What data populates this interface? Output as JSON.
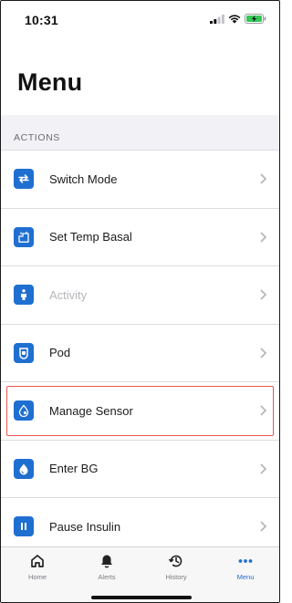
{
  "status_bar": {
    "time": "10:31",
    "icons": [
      "signal-icon",
      "wifi-icon",
      "battery-charging-icon"
    ]
  },
  "page": {
    "title": "Menu"
  },
  "section": {
    "header": "ACTIONS"
  },
  "menu_items": [
    {
      "label": "Switch Mode",
      "icon": "switch-mode-icon",
      "enabled": true,
      "highlighted": false
    },
    {
      "label": "Set Temp Basal",
      "icon": "temp-basal-icon",
      "enabled": true,
      "highlighted": false
    },
    {
      "label": "Activity",
      "icon": "activity-icon",
      "enabled": false,
      "highlighted": false
    },
    {
      "label": "Pod",
      "icon": "pod-icon",
      "enabled": true,
      "highlighted": false
    },
    {
      "label": "Manage Sensor",
      "icon": "sensor-icon",
      "enabled": true,
      "highlighted": true
    },
    {
      "label": "Enter BG",
      "icon": "drop-icon",
      "enabled": true,
      "highlighted": false
    },
    {
      "label": "Pause Insulin",
      "icon": "pause-icon",
      "enabled": true,
      "highlighted": false
    }
  ],
  "tabs": [
    {
      "label": "Home",
      "icon": "home-icon",
      "active": false
    },
    {
      "label": "Alerts",
      "icon": "bell-icon",
      "active": false
    },
    {
      "label": "History",
      "icon": "history-icon",
      "active": false
    },
    {
      "label": "Menu",
      "icon": "more-dots-icon",
      "active": true
    }
  ],
  "colors": {
    "accent": "#1f6fd1",
    "highlight_border": "#e7574f",
    "disabled_text": "#b6b6bb",
    "battery_green": "#34c759"
  }
}
